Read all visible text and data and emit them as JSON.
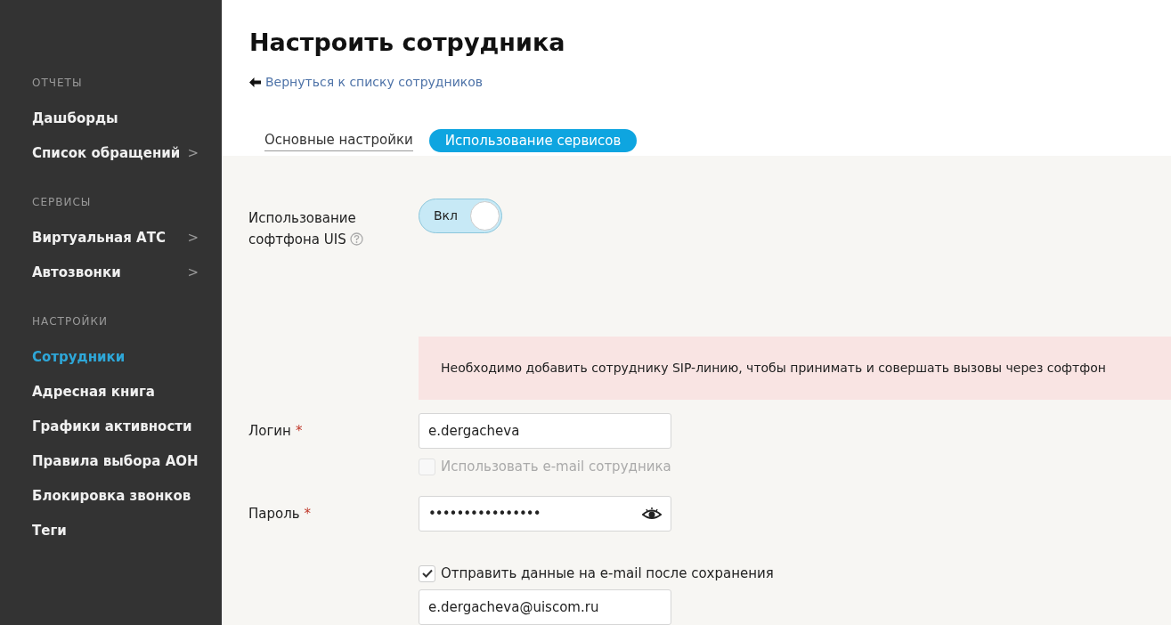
{
  "sidebar": {
    "sections": [
      {
        "heading": "ОТЧЕТЫ",
        "items": [
          {
            "label": "Дашборды",
            "selected": false
          },
          {
            "label": "Список обращений",
            "selected": false,
            "arrow": ">"
          }
        ]
      },
      {
        "heading": "СЕРВИСЫ",
        "items": [
          {
            "label": "Виртуальная АТС",
            "selected": false,
            "arrow": ">"
          },
          {
            "label": "Автозвонки",
            "selected": false,
            "arrow": ">"
          }
        ]
      },
      {
        "heading": "НАСТРОЙКИ",
        "items": [
          {
            "label": "Сотрудники",
            "selected": true
          },
          {
            "label": "Адресная книга",
            "selected": false
          },
          {
            "label": "Графики активности",
            "selected": false
          },
          {
            "label": "Правила выбора АОН",
            "selected": false
          },
          {
            "label": "Блокировка звонков",
            "selected": false
          },
          {
            "label": "Теги",
            "selected": false
          }
        ]
      }
    ]
  },
  "page": {
    "title": "Настроить сотрудника",
    "back_link": "Вернуться к списку сотрудников"
  },
  "tabs": [
    {
      "label": "Основные настройки",
      "selected": false
    },
    {
      "label": "Использование сервисов",
      "selected": true
    }
  ],
  "softphone": {
    "label": "Использование софтфона UIS",
    "toggle": {
      "on": true,
      "label": "Вкл"
    }
  },
  "alert": "Необходимо добавить сотруднику SIP-линию, чтобы принимать и совершать вызовы через софтфон",
  "login": {
    "label": "Логин",
    "required_mark": "*",
    "value": "e.dergacheva",
    "checkbox": {
      "label": "Использовать e-mail сотрудника",
      "checked": false,
      "disabled": true
    }
  },
  "password": {
    "label": "Пароль",
    "required_mark": "*",
    "value": "••••••••••••••••"
  },
  "send_email": {
    "label": "Отправить данные на e-mail после сохранения",
    "checked": true,
    "disabled": false,
    "value": "e.dergacheva@uiscom.ru"
  }
}
